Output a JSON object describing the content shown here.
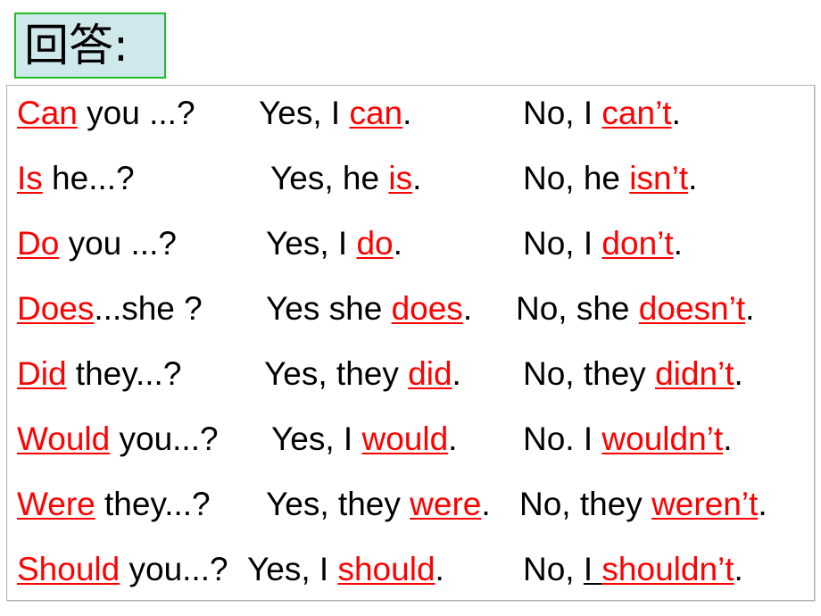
{
  "slide": {
    "title": "回答:",
    "title_box": {
      "fill_color": "#cfe8ec",
      "border_color": "#1fbd28"
    },
    "accent_color": "#ff0000",
    "text_color": "#000000",
    "frame_border_color": "#b0b0b0"
  },
  "table": {
    "columns": [
      "question",
      "affirmative_answer",
      "negative_answer"
    ],
    "rows": [
      {
        "question": {
          "pre": "",
          "aux": "Can",
          "post": " you ...?"
        },
        "affirmative": {
          "pre": "Yes, I ",
          "aux": "can",
          "post": "."
        },
        "negative": {
          "pre": "No, I ",
          "aux": "can’t",
          "post": "."
        }
      },
      {
        "question": {
          "pre": "",
          "aux": "Is",
          "post": " he...?"
        },
        "affirmative": {
          "pre": "Yes, he ",
          "aux": "is",
          "post": "."
        },
        "negative": {
          "pre": "No, he ",
          "aux": "isn’t",
          "post": "."
        }
      },
      {
        "question": {
          "pre": "",
          "aux": "Do",
          "post": " you ...?"
        },
        "affirmative": {
          "pre": "Yes, I ",
          "aux": "do",
          "post": "."
        },
        "negative": {
          "pre": "No, I ",
          "aux": "don’t",
          "post": "."
        }
      },
      {
        "question": {
          "pre": "",
          "aux": "Does",
          "post": "...she ?"
        },
        "affirmative": {
          "pre": "Yes she ",
          "aux": "does",
          "post": "."
        },
        "negative": {
          "pre": "No, she ",
          "aux": "doesn’t",
          "post": "."
        }
      },
      {
        "question": {
          "pre": "",
          "aux": "Did",
          "post": " they...?"
        },
        "affirmative": {
          "pre": "Yes, they ",
          "aux": "did",
          "post": "."
        },
        "negative": {
          "pre": "No, they ",
          "aux": "didn’t",
          "post": "."
        }
      },
      {
        "question": {
          "pre": "",
          "aux": "Would",
          "post": " you...?"
        },
        "affirmative": {
          "pre": "Yes, I ",
          "aux": "would",
          "post": "."
        },
        "negative": {
          "pre": "No. I ",
          "aux": "wouldn’t",
          "post": "."
        }
      },
      {
        "question": {
          "pre": "",
          "aux": "Were",
          "post": " they...?"
        },
        "affirmative": {
          "pre": "Yes, they ",
          "aux": "were",
          "post": "."
        },
        "negative": {
          "pre": "No, they ",
          "aux": "weren’t",
          "post": "."
        }
      },
      {
        "question": {
          "pre": "",
          "aux": "Should",
          "post": " you...?"
        },
        "affirmative": {
          "pre": "Yes, I ",
          "aux": "should",
          "post": "."
        },
        "negative": {
          "pre": "No, ",
          "pre_underlined": "I ",
          "aux": "shouldn’t",
          "post": "."
        }
      }
    ]
  }
}
